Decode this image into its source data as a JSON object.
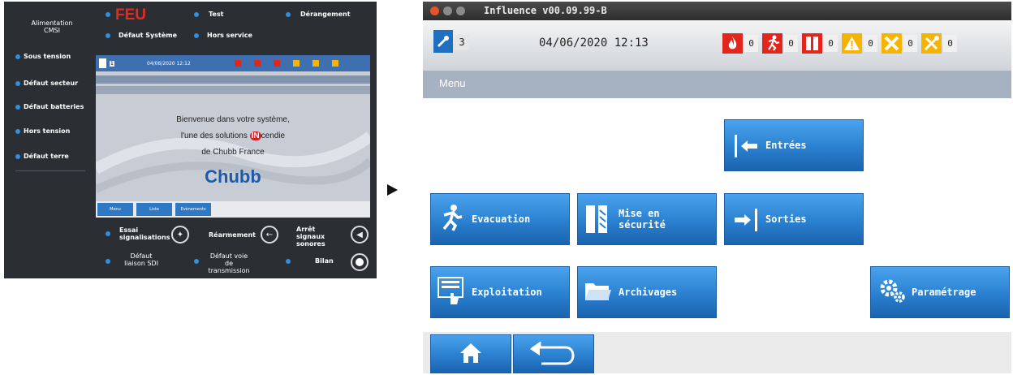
{
  "panel": {
    "top": {
      "alimentation": "Alimentation CMSI",
      "feu": "FEU",
      "test": "Test",
      "derangement": "Dérangement",
      "defaut_systeme": "Défaut Système",
      "hors_service": "Hors service"
    },
    "left_leds": [
      "Sous tension",
      "Défaut secteur",
      "Défaut batteries",
      "Hors tension",
      "Défaut terre"
    ],
    "screen": {
      "user_count": "1",
      "datetime": "04/06/2020  12:12",
      "welcome_line1": "Bienvenue dans votre système,",
      "welcome_line2_a": "l'une des solutions ",
      "welcome_line2_logo": "IN",
      "welcome_line2_b": "cendie",
      "welcome_line3": "de Chubb France",
      "brand": "Chubb",
      "tabs": [
        "Menu",
        "Liste",
        "Evènements"
      ]
    },
    "bottom": {
      "essai": "Essai signalisations",
      "rearmement": "Réarmement",
      "arret": "Arrêt signaux sonores",
      "defaut_liaison": "Défaut liaison SDI",
      "defaut_voie": "Défaut voie de transmission",
      "bilan": "Bilan"
    }
  },
  "window": {
    "title": "Influence v00.09.99-B",
    "status": {
      "user_count": "3",
      "datetime": "04/06/2020 12:13",
      "counters": [
        {
          "icon": "fire-icon",
          "color": "#e2261c",
          "count": "0"
        },
        {
          "icon": "evacuation-icon",
          "color": "#e2261c",
          "count": "0"
        },
        {
          "icon": "door-icon",
          "color": "#e2261c",
          "count": "0"
        },
        {
          "icon": "warning-icon",
          "color": "#f5b400",
          "count": "0"
        },
        {
          "icon": "cross-icon",
          "color": "#f5b400",
          "count": "0"
        },
        {
          "icon": "tools-icon",
          "color": "#f5b400",
          "count": "0"
        }
      ]
    },
    "menu_label": "Menu",
    "tiles": {
      "entrees": "Entrées",
      "evacuation": "Evacuation",
      "mise_en_securite_1": "Mise en",
      "mise_en_securite_2": "sécurité",
      "sorties": "Sorties",
      "exploitation": "Exploitation",
      "archivages": "Archivages",
      "parametrage": "Paramétrage"
    },
    "colors": {
      "tile": "#2a80cf",
      "alarm": "#e2261c",
      "fault": "#f5b400"
    }
  }
}
